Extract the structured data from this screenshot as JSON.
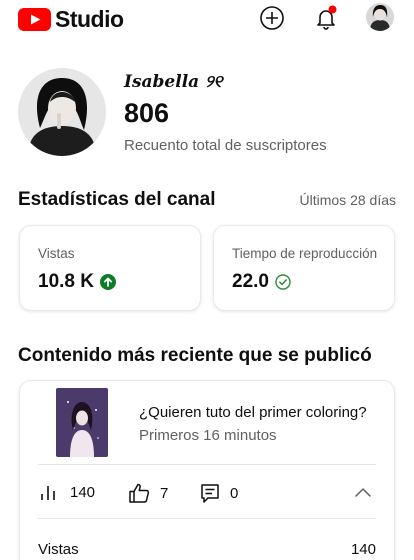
{
  "app": {
    "logo_text": "Studio",
    "brand_color": "#ff0000"
  },
  "header_icons": [
    "create-plus-icon",
    "notification-bell-icon",
    "account-avatar"
  ],
  "notification_dot_color": "#ff0000",
  "channel": {
    "name": "𝑰𝒔𝒂𝒃𝒆𝒍𝒍𝒂 ୨୧",
    "subscriber_count": "806",
    "subscriber_label": "Recuento total de suscriptores"
  },
  "stats": {
    "title": "Estadísticas del canal",
    "period": "Últimos 28 días",
    "cards": [
      {
        "label": "Vistas",
        "value": "10.8 K",
        "badge": "arrow-up-circle-icon",
        "badge_color": "#0f7a28"
      },
      {
        "label": "Tiempo de reproducción",
        "value": "22.0",
        "badge": "check-circle-icon",
        "badge_color": "#2e8b3e"
      }
    ]
  },
  "recent": {
    "title": "Contenido más reciente que se publicó",
    "video": {
      "title": "¿Quieren tuto del primer coloring?",
      "subtitle": "Primeros 16 minutos"
    },
    "metrics": {
      "views": "140",
      "likes": "7",
      "comments": "0"
    },
    "rows": [
      {
        "label": "Vistas",
        "value": "140"
      }
    ]
  }
}
